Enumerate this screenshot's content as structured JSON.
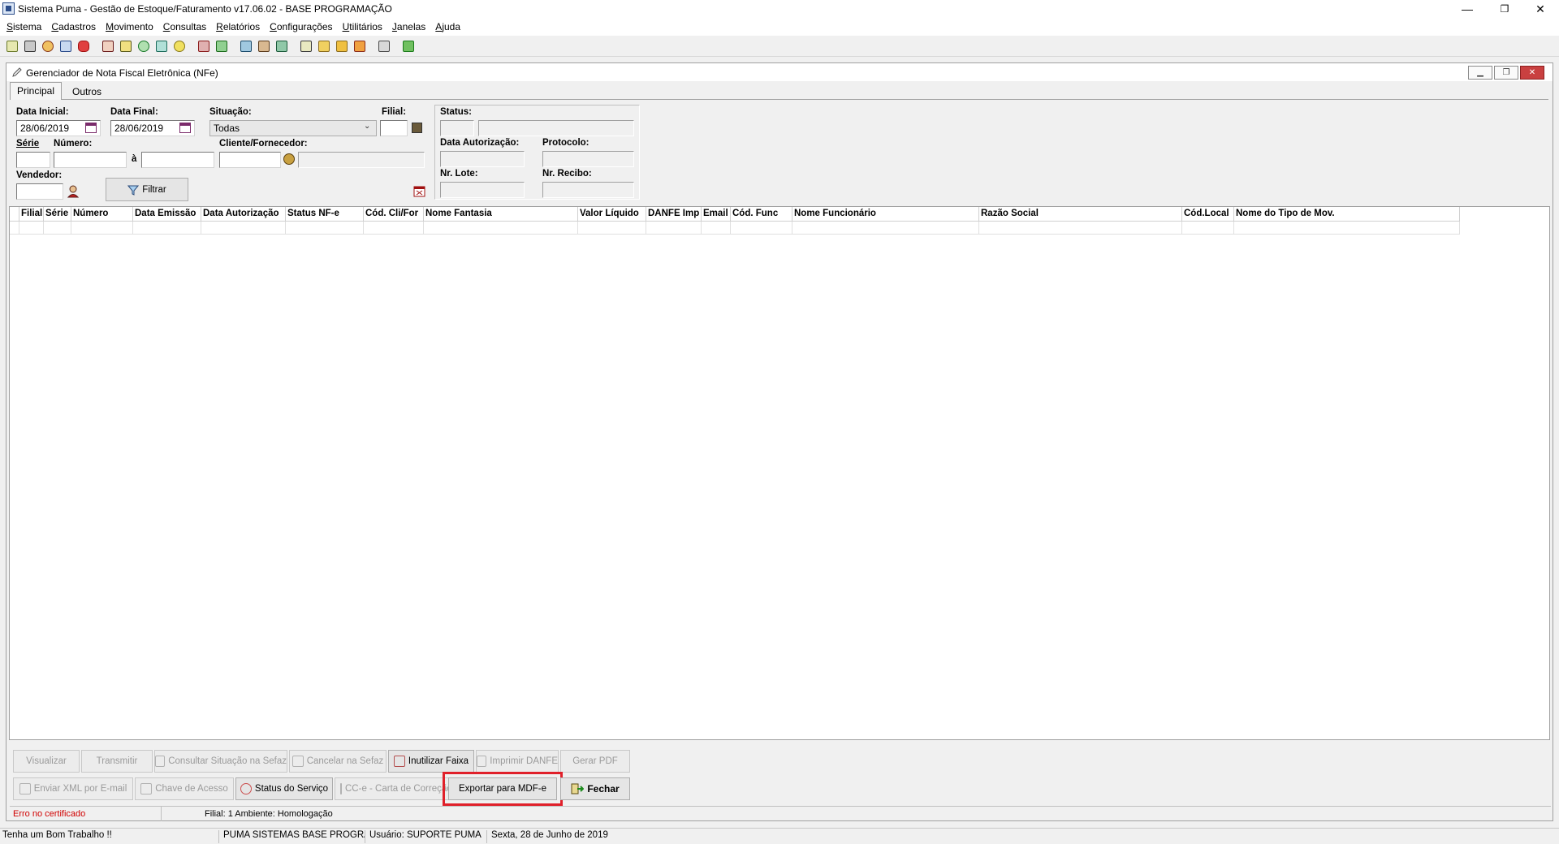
{
  "window": {
    "title": "Sistema Puma - Gestão de Estoque/Faturamento v17.06.02 - BASE PROGRAMAÇÃO",
    "controls": {
      "minimize": "—",
      "restore": "❐",
      "close": "✕"
    }
  },
  "menu": [
    "Sistema",
    "Cadastros",
    "Movimento",
    "Consultas",
    "Relatórios",
    "Configurações",
    "Utilitários",
    "Janelas",
    "Ajuda"
  ],
  "child": {
    "title": "Gerenciador de Nota Fiscal Eletrônica (NFe)",
    "controls": {
      "minimize": "▁",
      "restore": "❐",
      "close": "✕"
    },
    "tabs": [
      "Principal",
      "Outros"
    ]
  },
  "filters": {
    "data_inicial_label": "Data Inicial:",
    "data_inicial": "28/06/2019",
    "data_final_label": "Data Final:",
    "data_final": "28/06/2019",
    "situacao_label": "Situação:",
    "situacao": "Todas",
    "filial_label": "Filial:",
    "filial": "",
    "serie_label": "Série",
    "serie": "",
    "numero_label": "Número:",
    "numero_ini": "",
    "ate": "à",
    "numero_fim": "",
    "cliente_label": "Cliente/Fornecedor:",
    "cliente_code": "",
    "cliente_name": "",
    "vendedor_label": "Vendedor:",
    "vendedor": "",
    "filtrar": "Filtrar"
  },
  "status_panel": {
    "status_label": "Status:",
    "data_autorizacao_label": "Data Autorização:",
    "protocolo_label": "Protocolo:",
    "nr_lote_label": "Nr. Lote:",
    "nr_recibo_label": "Nr. Recibo:"
  },
  "grid": {
    "columns": [
      "",
      "Filial",
      "Série",
      "Número",
      "Data Emissão",
      "Data Autorização",
      "Status NF-e",
      "Cód. Cli/For",
      "Nome Fantasia",
      "Valor Líquido",
      "DANFE Imp",
      "Email",
      "Cód. Func",
      "Nome Funcionário",
      "Razão Social",
      "Cód.Local",
      "Nome do Tipo de Mov."
    ]
  },
  "buttons_row1": [
    "Visualizar",
    "Transmitir",
    "Consultar Situação na Sefaz",
    "Cancelar na Sefaz",
    "Inutilizar Faixa",
    "Imprimir DANFE",
    "Gerar PDF"
  ],
  "buttons_row2": [
    "Enviar XML por E-mail",
    "Chave de Acesso",
    "Status do Serviço",
    "CC-e - Carta de Correção",
    "Exportar para MDF-e",
    "Fechar"
  ],
  "child_status": {
    "error": "Erro no certificado",
    "info": "Filial: 1 Ambiente: Homologação"
  },
  "app_status": {
    "message": "Tenha um Bom Trabalho !!",
    "company": "PUMA SISTEMAS  BASE PROGRAMAÇÃO",
    "user": "Usuário: SUPORTE PUMA",
    "date": "Sexta, 28 de Junho de 2019"
  },
  "colors": {
    "highlight": "#e0202a",
    "error_text": "#d00000"
  }
}
